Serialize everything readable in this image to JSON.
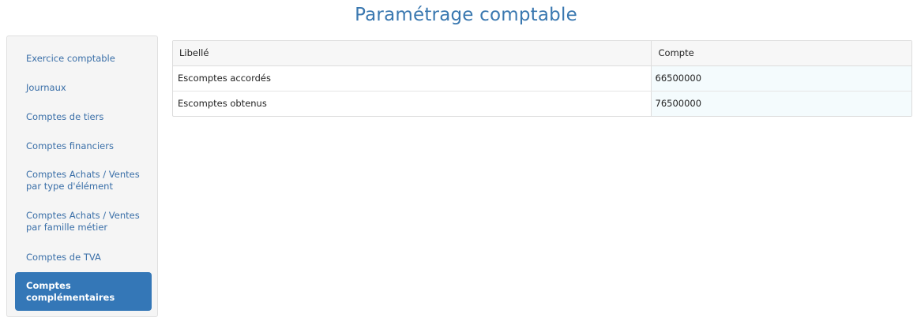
{
  "title": "Paramétrage comptable",
  "colors": {
    "title": "#3a78b0",
    "link": "#3a6fa8",
    "active_bg": "#3477b7",
    "active_text": "#ffffff",
    "account_cell_bg": "#f4fbfd"
  },
  "sidebar": {
    "items": [
      {
        "label": "Exercice comptable",
        "active": false
      },
      {
        "label": "Journaux",
        "active": false
      },
      {
        "label": "Comptes de tiers",
        "active": false
      },
      {
        "label": "Comptes financiers",
        "active": false
      },
      {
        "label": "Comptes Achats / Ventes par type d'élément",
        "active": false
      },
      {
        "label": "Comptes Achats / Ventes par famille métier",
        "active": false
      },
      {
        "label": "Comptes de TVA",
        "active": false
      },
      {
        "label": "Comptes complémentaires",
        "active": true
      }
    ]
  },
  "table": {
    "headers": [
      "Libellé",
      "Compte"
    ],
    "rows": [
      {
        "libelle": "Escomptes accordés",
        "compte": "66500000"
      },
      {
        "libelle": "Escomptes obtenus",
        "compte": "76500000"
      }
    ]
  }
}
